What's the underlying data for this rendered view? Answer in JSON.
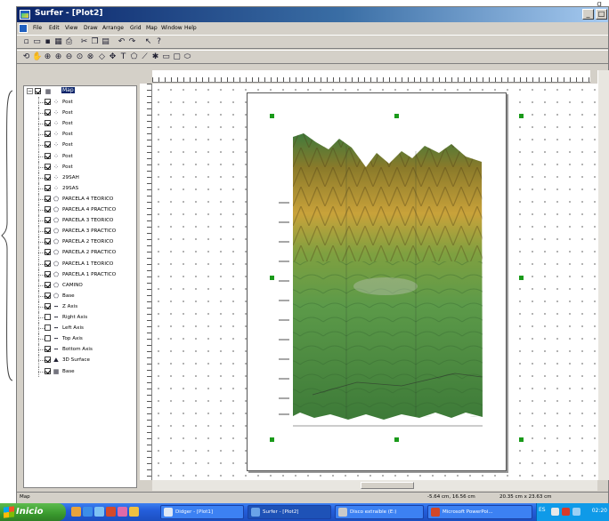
{
  "outer": {
    "fragment": "g"
  },
  "window": {
    "title": "Surfer - [Plot2]",
    "controls": [
      "_",
      "□"
    ]
  },
  "menu": [
    "File",
    "Edit",
    "View",
    "Draw",
    "Arrange",
    "Grid",
    "Map",
    "Window",
    "Help"
  ],
  "tree": {
    "root": "Map",
    "items": [
      {
        "label": "Post",
        "icon": "post-icon"
      },
      {
        "label": "Post",
        "icon": "post-icon"
      },
      {
        "label": "Post",
        "icon": "post-icon"
      },
      {
        "label": "Post",
        "icon": "post-icon"
      },
      {
        "label": "Post",
        "icon": "post-icon"
      },
      {
        "label": "Post",
        "icon": "post-icon"
      },
      {
        "label": "Post",
        "icon": "post-icon"
      },
      {
        "label": "29SAH",
        "icon": "post-icon"
      },
      {
        "label": "29SAS",
        "icon": "post-icon"
      },
      {
        "label": "PARCELA 4 TEORICO",
        "icon": "polygon-icon"
      },
      {
        "label": "PARCELA 4 PRACTICO",
        "icon": "polygon-icon"
      },
      {
        "label": "PARCELA 3 TEORICO",
        "icon": "polygon-icon"
      },
      {
        "label": "PARCELA 3 PRACTICO",
        "icon": "polygon-icon"
      },
      {
        "label": "PARCELA 2 TEORICO",
        "icon": "polygon-icon"
      },
      {
        "label": "PARCELA 2 PRACTICO",
        "icon": "polygon-icon"
      },
      {
        "label": "PARCELA 1 TEORICO",
        "icon": "polygon-icon"
      },
      {
        "label": "PARCELA 1 PRACTICO",
        "icon": "polygon-icon"
      },
      {
        "label": "CAMINO",
        "icon": "polygon-icon"
      },
      {
        "label": "Base",
        "icon": "polygon-icon"
      },
      {
        "label": "Z Axis",
        "icon": "axis-icon"
      },
      {
        "label": "Right Axis",
        "icon": "axis-icon"
      },
      {
        "label": "Left Axis",
        "icon": "axis-icon"
      },
      {
        "label": "Top Axis",
        "icon": "axis-icon"
      },
      {
        "label": "Bottom Axis",
        "icon": "axis-icon"
      },
      {
        "label": "3D Surface",
        "icon": "surface-icon"
      },
      {
        "label": "Base",
        "icon": "base-icon"
      }
    ]
  },
  "status": {
    "left": "Map",
    "cursor": "-5.64 cm, 16.56 cm",
    "size": "20.35 cm x 23.63 cm"
  },
  "taskbar": {
    "start": "Inicio",
    "buttons": [
      "Didger - [Plot1]",
      "Surfer - [Plot2]",
      "Disco extraíble (E:)",
      "Microsoft PowerPoi..."
    ],
    "active_index": 1,
    "tray_label": "ES",
    "clock": "02:20"
  },
  "colors": {
    "title_start": "#0a246a",
    "title_end": "#a6caf0",
    "taskbar": "#245edb",
    "start_green": "#3a9a2e",
    "handle": "#1a9a1a"
  }
}
